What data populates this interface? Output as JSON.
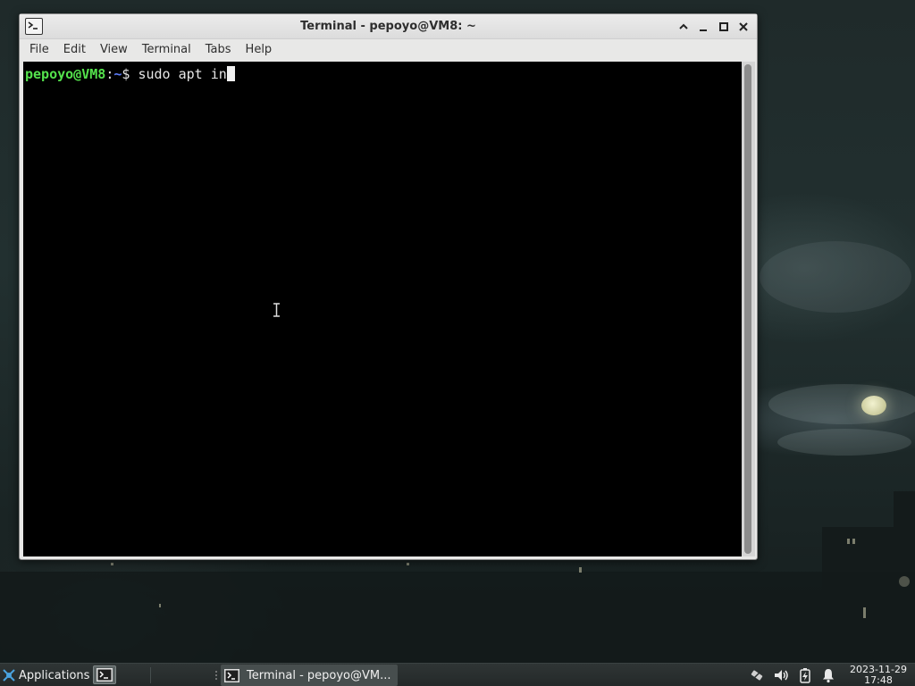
{
  "window": {
    "title": "Terminal - pepoyo@VM8: ~",
    "menu": [
      "File",
      "Edit",
      "View",
      "Terminal",
      "Tabs",
      "Help"
    ]
  },
  "terminal": {
    "prompt_user": "pepoyo@VM8",
    "prompt_colon": ":",
    "prompt_path": "~",
    "prompt_symbol": "$ ",
    "command": "sudo apt in"
  },
  "taskbar": {
    "applications_label": "Applications",
    "task_label": "Terminal - pepoyo@VM...",
    "clock_date": "2023-11-29",
    "clock_time": "17:48"
  },
  "colors": {
    "prompt_user": "#54e24c",
    "prompt_path": "#5c7cfa",
    "terminal_bg": "#000000"
  }
}
